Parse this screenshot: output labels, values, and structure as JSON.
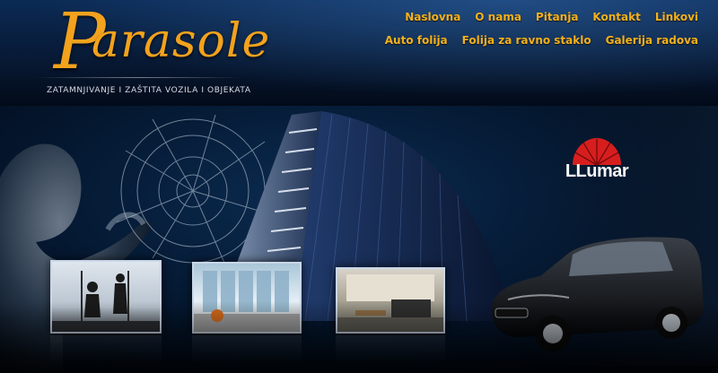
{
  "brand": {
    "name": "Parasole",
    "tagline": "ZATAMNJIVANJE I ZAŠTITA VOZILA I OBJEKATA"
  },
  "nav": {
    "row1": [
      "Naslovna",
      "O nama",
      "Pitanja",
      "Kontakt",
      "Linkovi"
    ],
    "row2": [
      "Auto folija",
      "Folija za ravno staklo",
      "Galerija radova"
    ]
  },
  "partner": {
    "name": "LLumar"
  },
  "colors": {
    "accent": "#f5b11b",
    "background": "#061a36"
  }
}
